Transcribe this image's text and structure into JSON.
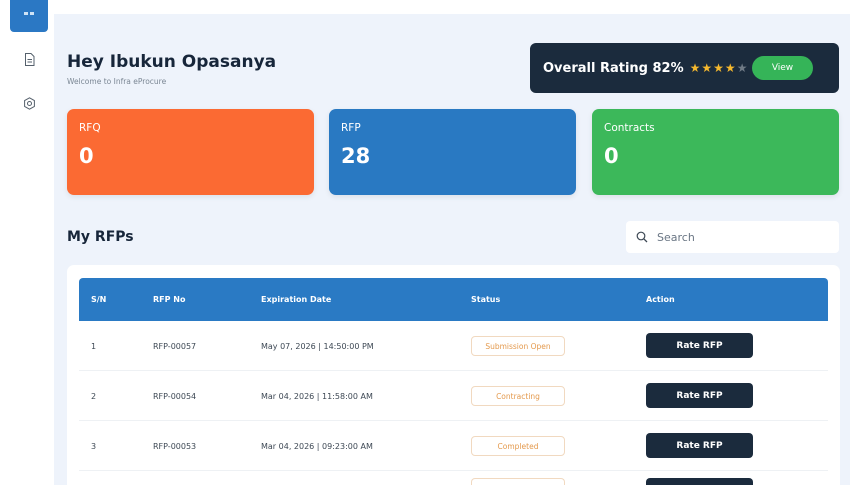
{
  "sidebar": {
    "active_icon": "grid-icon",
    "items": [
      {
        "icon": "document-icon"
      },
      {
        "icon": "settings-icon"
      }
    ]
  },
  "header": {
    "greeting": "Hey Ibukun Opasanya",
    "subtitle": "Welcome to Infra eProcure"
  },
  "rating": {
    "label": "Overall Rating 82%",
    "stars_filled": 4,
    "stars_total": 5,
    "view_label": "View"
  },
  "stats": [
    {
      "label": "RFQ",
      "value": "0",
      "color": "#fb6a33"
    },
    {
      "label": "RFP",
      "value": "28",
      "color": "#2979c2"
    },
    {
      "label": "Contracts",
      "value": "0",
      "color": "#3cb85a"
    }
  ],
  "section": {
    "title": "My RFPs",
    "search_placeholder": "Search"
  },
  "table": {
    "headers": [
      "S/N",
      "RFP No",
      "Expiration Date",
      "Status",
      "Action"
    ],
    "rows": [
      {
        "sn": "1",
        "rfp_no": "RFP-00057",
        "expiration": "May 07, 2026 | 14:50:00 PM",
        "status": "Submission Open",
        "action": "Rate RFP"
      },
      {
        "sn": "2",
        "rfp_no": "RFP-00054",
        "expiration": "Mar 04, 2026 | 11:58:00 AM",
        "status": "Contracting",
        "action": "Rate RFP"
      },
      {
        "sn": "3",
        "rfp_no": "RFP-00053",
        "expiration": "Mar 04, 2026 | 09:23:00 AM",
        "status": "Completed",
        "action": "Rate RFP"
      }
    ]
  },
  "colors": {
    "accent_blue": "#2a7ac4",
    "dark_navy": "#1b2b3d",
    "green": "#35b458",
    "star": "#f5b82e"
  }
}
